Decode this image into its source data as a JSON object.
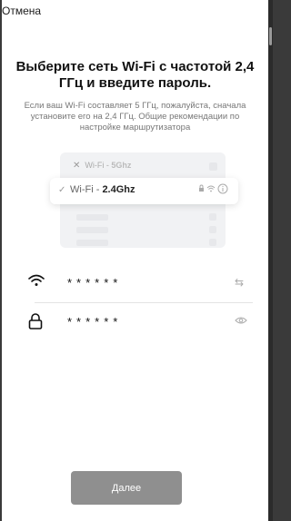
{
  "header": {
    "cancel_label": "Отмена"
  },
  "title": "Выберите сеть Wi-Fi с частотой 2,4 ГГц и введите пароль.",
  "description": "Если ваш Wi-Fi составляет 5 ГГц, пожалуйста, сначала установите его на 2,4 ГГц. Общие рекомендации по настройке маршрутизатора",
  "illustration": {
    "row1_prefix": "Wi-Fi - ",
    "row1_band": "5Ghz",
    "row2_prefix": "Wi-Fi - ",
    "row2_band": "2.4Ghz",
    "row1_mark": "✕",
    "row2_mark": "✓"
  },
  "network_field": {
    "value": "******",
    "icon": "wifi-icon",
    "action_icon": "swap-icon"
  },
  "password_field": {
    "value": "******",
    "icon": "lock-icon",
    "action_icon": "eye-icon"
  },
  "next_button": {
    "label": "Далее"
  },
  "colors": {
    "button": "#8f8f8f",
    "divider": "#e3e3e3",
    "text": "#111111",
    "muted": "#777777"
  }
}
